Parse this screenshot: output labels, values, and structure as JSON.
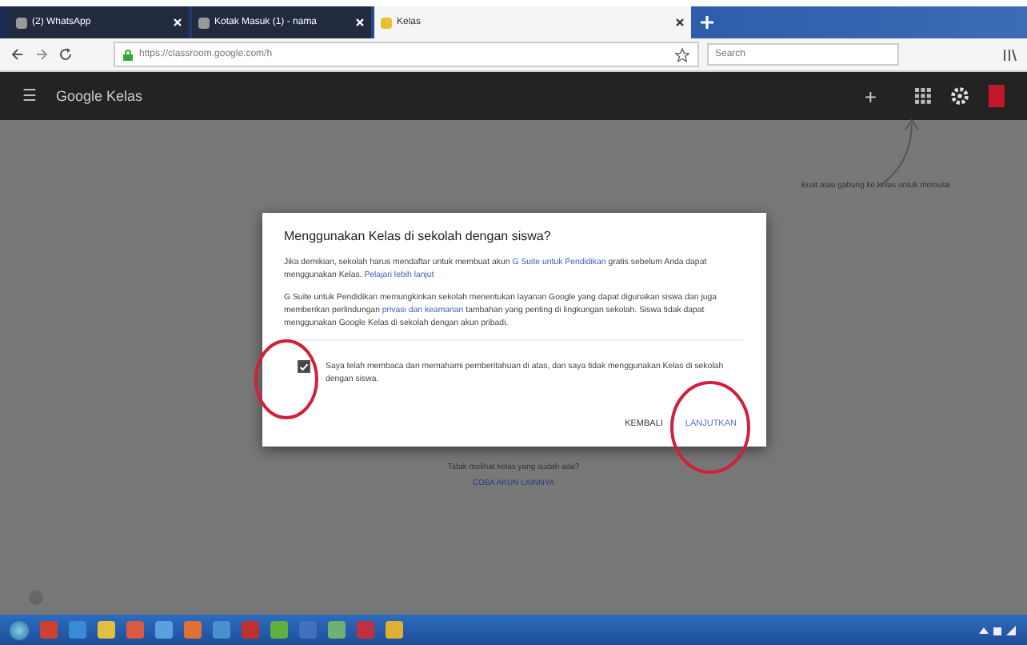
{
  "browser": {
    "tabs": [
      {
        "title": "(2) WhatsApp",
        "selected": false
      },
      {
        "title": "Kotak Masuk (1) - nama",
        "selected": false
      },
      {
        "title": "Kelas",
        "selected": true
      }
    ],
    "url": "https://classroom.google.com/h",
    "search": {
      "placeholder": "Search"
    }
  },
  "app_bar": {
    "menu": "☰",
    "title": "Google Kelas",
    "add": "+"
  },
  "hint": "Buat atau gabung ke kelas untuk memulai",
  "dialog": {
    "title": "Menggunakan Kelas di sekolah dengan siswa?",
    "paragraphs": [
      [
        {
          "text": "Jika demikian, sekolah harus mendaftar untuk membuat akun ",
          "link": false
        },
        {
          "text": "G Suite untuk Pendidikan",
          "link": true
        },
        {
          "text": " gratis sebelum Anda dapat menggunakan Kelas. ",
          "link": false
        },
        {
          "text": "Pelajari lebih lanjut",
          "link": true
        }
      ],
      [
        {
          "text": "G Suite untuk Pendidikan memungkinkan sekolah menentukan layanan Google yang dapat digunakan siswa dan juga memberikan perlindungan ",
          "link": false
        },
        {
          "text": "privasi dan keamanan",
          "link": true
        },
        {
          "text": " tambahan yang penting di lingkungan sekolah. Siswa tidak dapat menggunakan Google Kelas di sekolah dengan akun pribadi.",
          "link": false
        }
      ]
    ],
    "checkbox": {
      "label": "Saya telah membaca dan memahami pemberitahuan di atas, dan saya tidak menggunakan Kelas di sekolah dengan siswa.",
      "checked": true
    },
    "buttons": [
      {
        "label": "KEMBALI",
        "kind": "plain"
      },
      {
        "label": "LANJUTKAN",
        "kind": "primary"
      }
    ]
  },
  "below": {
    "text": "Tidak melihat kelas yang sudah ada?",
    "link": "COBA AKUN LAINNYA"
  }
}
